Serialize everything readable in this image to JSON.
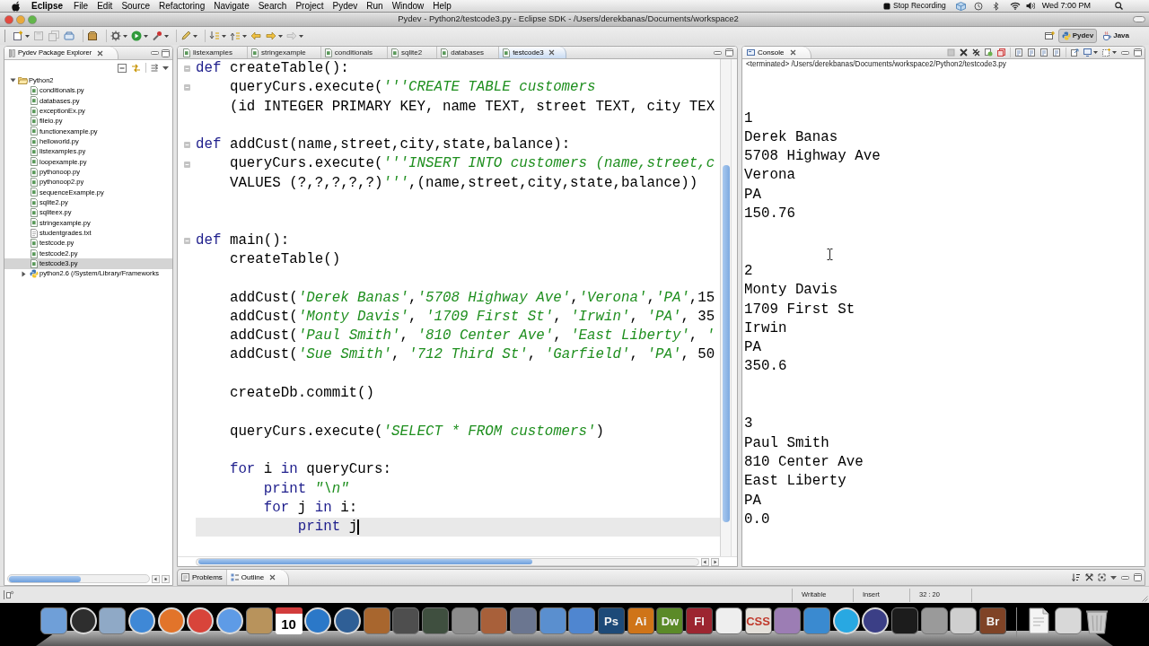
{
  "menu_bar": {
    "app_name": "Eclipse",
    "menus": [
      "File",
      "Edit",
      "Source",
      "Refactoring",
      "Navigate",
      "Search",
      "Project",
      "Pydev",
      "Run",
      "Window",
      "Help"
    ],
    "recording": "Stop Recording",
    "clock": "Wed 7:00 PM"
  },
  "window": {
    "title": "Pydev - Python2/testcode3.py - Eclipse SDK - /Users/derekbanas/Documents/workspace2"
  },
  "perspectives": [
    {
      "label": "Pydev",
      "selected": true
    },
    {
      "label": "Java",
      "selected": false
    }
  ],
  "package_explorer": {
    "title": "Pydev Package Explorer",
    "tree": [
      {
        "label": "Python2",
        "kind": "project",
        "expanded": true,
        "selected": false,
        "children": [
          {
            "label": "conditionals.py",
            "kind": "module",
            "selected": false
          },
          {
            "label": "databases.py",
            "kind": "module",
            "selected": false
          },
          {
            "label": "exceptionEx.py",
            "kind": "module",
            "selected": false
          },
          {
            "label": "fileio.py",
            "kind": "module",
            "selected": false
          },
          {
            "label": "functionexample.py",
            "kind": "module",
            "selected": false
          },
          {
            "label": "helloworld.py",
            "kind": "module",
            "selected": false
          },
          {
            "label": "listexamples.py",
            "kind": "module",
            "selected": false
          },
          {
            "label": "loopexample.py",
            "kind": "module",
            "selected": false
          },
          {
            "label": "pythonoop.py",
            "kind": "module",
            "selected": false
          },
          {
            "label": "pythonoop2.py",
            "kind": "module",
            "selected": false
          },
          {
            "label": "sequenceExample.py",
            "kind": "module",
            "selected": false
          },
          {
            "label": "sqlite2.py",
            "kind": "module",
            "selected": false
          },
          {
            "label": "sqliteex.py",
            "kind": "module",
            "selected": false
          },
          {
            "label": "stringexample.py",
            "kind": "module",
            "selected": false
          },
          {
            "label": "studentgrades.txt",
            "kind": "text",
            "selected": false
          },
          {
            "label": "testcode.py",
            "kind": "module",
            "selected": false
          },
          {
            "label": "testcode2.py",
            "kind": "module",
            "selected": false
          },
          {
            "label": "testcode3.py",
            "kind": "module",
            "selected": true
          },
          {
            "label": "python2.6 (/System/Library/Frameworks",
            "kind": "library",
            "expanded": false,
            "selected": false
          }
        ]
      }
    ]
  },
  "editor": {
    "tabs": [
      {
        "label": "listexamples",
        "selected": false
      },
      {
        "label": "stringexample",
        "selected": false
      },
      {
        "label": "conditionals",
        "selected": false
      },
      {
        "label": "sqlite2",
        "selected": false
      },
      {
        "label": "databases",
        "selected": false
      },
      {
        "label": "testcode3",
        "selected": true
      }
    ],
    "lines": [
      {
        "kind": "code",
        "collapsible": true,
        "current": false,
        "tokens": [
          {
            "kind": "keyword",
            "text": "def"
          },
          {
            "kind": "plain",
            "text": " createTable():"
          }
        ],
        "children": [
          {
            "kind": "code",
            "collapsible": true,
            "current": false,
            "tokens": [
              {
                "kind": "plain",
                "text": "queryCurs.execute("
              },
              {
                "kind": "string",
                "text": "'''CREATE TABLE customers"
              }
            ]
          },
          {
            "kind": "code",
            "collapsible": false,
            "current": false,
            "tokens": [
              {
                "kind": "plain",
                "text": "(id INTEGER PRIMARY KEY, name TEXT, street TEXT, city TEX"
              }
            ]
          }
        ]
      },
      {
        "kind": "blank",
        "collapsible": false,
        "current": false
      },
      {
        "kind": "code",
        "collapsible": true,
        "current": false,
        "tokens": [
          {
            "kind": "keyword",
            "text": "def"
          },
          {
            "kind": "plain",
            "text": " addCust(name,street,city,state,balance):"
          }
        ],
        "children": [
          {
            "kind": "code",
            "collapsible": true,
            "current": false,
            "tokens": [
              {
                "kind": "plain",
                "text": "queryCurs.execute("
              },
              {
                "kind": "string",
                "text": "'''INSERT INTO customers (name,street,c"
              }
            ]
          },
          {
            "kind": "code",
            "collapsible": false,
            "current": false,
            "tokens": [
              {
                "kind": "plain",
                "text": "VALUES (?,?,?,?,?)"
              },
              {
                "kind": "string",
                "text": "'''"
              },
              {
                "kind": "plain",
                "text": ",(name,street,city,state,balance))"
              }
            ]
          }
        ]
      },
      {
        "kind": "blank",
        "collapsible": false,
        "current": false
      },
      {
        "kind": "blank",
        "collapsible": false,
        "current": false
      },
      {
        "kind": "code",
        "collapsible": true,
        "current": false,
        "tokens": [
          {
            "kind": "keyword",
            "text": "def"
          },
          {
            "kind": "plain",
            "text": " main():"
          }
        ],
        "children": [
          {
            "kind": "code",
            "collapsible": false,
            "current": false,
            "tokens": [
              {
                "kind": "plain",
                "text": "createTable()"
              }
            ]
          },
          {
            "kind": "blank",
            "collapsible": false,
            "current": false
          },
          {
            "kind": "code",
            "collapsible": false,
            "current": false,
            "tokens": [
              {
                "kind": "plain",
                "text": "addCust("
              },
              {
                "kind": "string",
                "text": "'Derek Banas'"
              },
              {
                "kind": "plain",
                "text": ","
              },
              {
                "kind": "string",
                "text": "'5708 Highway Ave'"
              },
              {
                "kind": "plain",
                "text": ","
              },
              {
                "kind": "string",
                "text": "'Verona'"
              },
              {
                "kind": "plain",
                "text": ","
              },
              {
                "kind": "string",
                "text": "'PA'"
              },
              {
                "kind": "plain",
                "text": ",15"
              }
            ]
          },
          {
            "kind": "code",
            "collapsible": false,
            "current": false,
            "tokens": [
              {
                "kind": "plain",
                "text": "addCust("
              },
              {
                "kind": "string",
                "text": "'Monty Davis'"
              },
              {
                "kind": "plain",
                "text": ", "
              },
              {
                "kind": "string",
                "text": "'1709 First St'"
              },
              {
                "kind": "plain",
                "text": ", "
              },
              {
                "kind": "string",
                "text": "'Irwin'"
              },
              {
                "kind": "plain",
                "text": ", "
              },
              {
                "kind": "string",
                "text": "'PA'"
              },
              {
                "kind": "plain",
                "text": ", 35"
              }
            ]
          },
          {
            "kind": "code",
            "collapsible": false,
            "current": false,
            "tokens": [
              {
                "kind": "plain",
                "text": "addCust("
              },
              {
                "kind": "string",
                "text": "'Paul Smith'"
              },
              {
                "kind": "plain",
                "text": ", "
              },
              {
                "kind": "string",
                "text": "'810 Center Ave'"
              },
              {
                "kind": "plain",
                "text": ", "
              },
              {
                "kind": "string",
                "text": "'East Liberty'"
              },
              {
                "kind": "plain",
                "text": ", "
              },
              {
                "kind": "string",
                "text": "'"
              }
            ]
          },
          {
            "kind": "code",
            "collapsible": false,
            "current": false,
            "tokens": [
              {
                "kind": "plain",
                "text": "addCust("
              },
              {
                "kind": "string",
                "text": "'Sue Smith'"
              },
              {
                "kind": "plain",
                "text": ", "
              },
              {
                "kind": "string",
                "text": "'712 Third St'"
              },
              {
                "kind": "plain",
                "text": ", "
              },
              {
                "kind": "string",
                "text": "'Garfield'"
              },
              {
                "kind": "plain",
                "text": ", "
              },
              {
                "kind": "string",
                "text": "'PA'"
              },
              {
                "kind": "plain",
                "text": ", 50"
              }
            ]
          },
          {
            "kind": "blank",
            "collapsible": false,
            "current": false
          },
          {
            "kind": "code",
            "collapsible": false,
            "current": false,
            "tokens": [
              {
                "kind": "plain",
                "text": "createDb.commit()"
              }
            ]
          },
          {
            "kind": "blank",
            "collapsible": false,
            "current": false
          },
          {
            "kind": "code",
            "collapsible": false,
            "current": false,
            "tokens": [
              {
                "kind": "plain",
                "text": "queryCurs.execute("
              },
              {
                "kind": "string",
                "text": "'SELECT * FROM customers'"
              },
              {
                "kind": "plain",
                "text": ")"
              }
            ]
          },
          {
            "kind": "blank",
            "collapsible": false,
            "current": false
          },
          {
            "kind": "code",
            "collapsible": false,
            "current": false,
            "tokens": [
              {
                "kind": "keyword",
                "text": "for"
              },
              {
                "kind": "plain",
                "text": " i "
              },
              {
                "kind": "keyword",
                "text": "in"
              },
              {
                "kind": "plain",
                "text": " queryCurs:"
              }
            ],
            "children": [
              {
                "kind": "code",
                "collapsible": false,
                "current": false,
                "tokens": [
                  {
                    "kind": "keyword",
                    "text": "print"
                  },
                  {
                    "kind": "string",
                    "text": " \"\\n\""
                  }
                ]
              },
              {
                "kind": "code",
                "collapsible": false,
                "current": false,
                "tokens": [
                  {
                    "kind": "keyword",
                    "text": "for"
                  },
                  {
                    "kind": "plain",
                    "text": " j "
                  },
                  {
                    "kind": "keyword",
                    "text": "in"
                  },
                  {
                    "kind": "plain",
                    "text": " i:"
                  }
                ],
                "children": [
                  {
                    "kind": "code",
                    "collapsible": false,
                    "current": true,
                    "tokens": [
                      {
                        "kind": "keyword",
                        "text": "print"
                      },
                      {
                        "kind": "plain",
                        "text": " j"
                      }
                    ]
                  }
                ]
              }
            ]
          }
        ]
      }
    ]
  },
  "console": {
    "title": "Console",
    "status": "<terminated> /Users/derekbanas/Documents/workspace2/Python2/testcode3.py",
    "records": [
      [
        "1",
        "Derek Banas",
        "5708 Highway Ave",
        "Verona",
        "PA",
        "150.76"
      ],
      [
        "2",
        "Monty Davis",
        "1709 First St",
        "Irwin",
        "PA",
        "350.6"
      ],
      [
        "3",
        "Paul Smith",
        "810 Center Ave",
        "East Liberty",
        "PA",
        "0.0"
      ]
    ]
  },
  "bottom_panel": {
    "tabs": [
      {
        "label": "Problems",
        "selected": false
      },
      {
        "label": "Outline",
        "selected": true
      }
    ]
  },
  "status_bar": [
    "Writable",
    "Insert",
    "32 : 20"
  ],
  "dock": {
    "apps": [
      {
        "kind": "square",
        "color": "#6f9fd8"
      },
      {
        "kind": "round",
        "color": "#2e2e2e"
      },
      {
        "kind": "square",
        "color": "#8fa9c6"
      },
      {
        "kind": "round",
        "color": "#3f88d6"
      },
      {
        "kind": "round",
        "color": "#e2742a"
      },
      {
        "kind": "round",
        "color": "#d8443a"
      },
      {
        "kind": "round",
        "color": "#5e9be6"
      },
      {
        "kind": "square",
        "color": "#b8935c"
      },
      {
        "kind": "calendar",
        "label": "10"
      },
      {
        "kind": "round",
        "color": "#2b78c8"
      },
      {
        "kind": "round",
        "color": "#2f5f96"
      },
      {
        "kind": "square",
        "color": "#a8662e"
      },
      {
        "kind": "square",
        "color": "#4e4e4e"
      },
      {
        "kind": "square",
        "color": "#3f4f3f"
      },
      {
        "kind": "square",
        "color": "#8c8c8c"
      },
      {
        "kind": "square",
        "color": "#a8603a"
      },
      {
        "kind": "square",
        "color": "#6b7690"
      },
      {
        "kind": "square",
        "color": "#5a8fcf"
      },
      {
        "kind": "square",
        "color": "#4f86d0"
      },
      {
        "kind": "letters",
        "label": "Ps",
        "color": "#1d4a78"
      },
      {
        "kind": "letters",
        "label": "Ai",
        "color": "#cf7418"
      },
      {
        "kind": "letters",
        "label": "Dw",
        "color": "#5b8a28"
      },
      {
        "kind": "letters",
        "label": "Fl",
        "color": "#9c2530"
      },
      {
        "kind": "square",
        "color": "#eeeeee"
      },
      {
        "kind": "letters",
        "label": "CSS",
        "color": "#e4e0da"
      },
      {
        "kind": "square",
        "color": "#9c7db4"
      },
      {
        "kind": "square",
        "color": "#3a8ad0"
      },
      {
        "kind": "round",
        "color": "#28a8e2"
      },
      {
        "kind": "round",
        "color": "#3b3f86"
      },
      {
        "kind": "square",
        "color": "#1c1c1c"
      },
      {
        "kind": "square",
        "color": "#9a9a9a"
      },
      {
        "kind": "square",
        "color": "#cfcfcf"
      },
      {
        "kind": "letters",
        "label": "Br",
        "color": "#7f4326"
      }
    ],
    "stacks": [
      {
        "kind": "page"
      },
      {
        "kind": "square",
        "color": "#d8d8d8"
      },
      {
        "kind": "trash"
      }
    ]
  }
}
